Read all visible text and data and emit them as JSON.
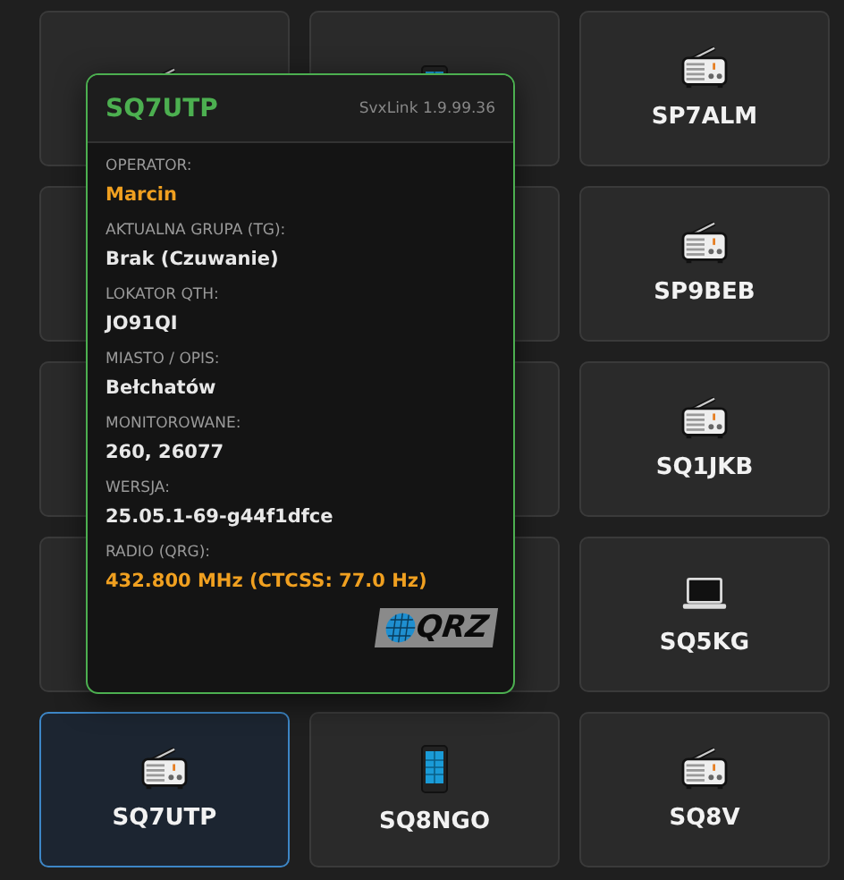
{
  "tiles": [
    {
      "kind": "radio",
      "selected": false
    },
    {
      "kind": "phone",
      "selected": false
    },
    {
      "kind": "radio",
      "call": "SP7ALM",
      "selected": false
    },
    {
      "selected": false
    },
    {
      "selected": false
    },
    {
      "kind": "radio",
      "call": "SP9BEB",
      "selected": false
    },
    {
      "selected": false
    },
    {
      "selected": false
    },
    {
      "kind": "radio",
      "call": "SQ1JKB",
      "selected": false
    },
    {
      "selected": false
    },
    {
      "selected": false
    },
    {
      "kind": "laptop",
      "call": "SQ5KG",
      "selected": false
    },
    {
      "kind": "radio",
      "call": "SQ7UTP",
      "selected": true
    },
    {
      "kind": "phone",
      "call": "SQ8NGO",
      "selected": false
    },
    {
      "kind": "radio",
      "call": "SQ8V",
      "selected": false
    }
  ],
  "popup": {
    "call": "SQ7UTP",
    "version": "SvxLink 1.9.99.36",
    "fields": [
      {
        "label": "OPERATOR:",
        "value": "Marcin",
        "highlight": true
      },
      {
        "label": "AKTUALNA GRUPA (TG):",
        "value": "Brak (Czuwanie)",
        "highlight": false
      },
      {
        "label": "LOKATOR QTH:",
        "value": "JO91QI",
        "highlight": false
      },
      {
        "label": "MIASTO / OPIS:",
        "value": "Bełchatów",
        "highlight": false
      },
      {
        "label": "MONITOROWANE:",
        "value": "260, 26077",
        "highlight": false
      },
      {
        "label": "WERSJA:",
        "value": "25.05.1-69-g44f1dfce",
        "highlight": false
      },
      {
        "label": "RADIO (QRG):",
        "value": "432.800 MHz (CTCSS: 77.0 Hz)",
        "highlight": true
      }
    ],
    "logo": "QRZ"
  }
}
